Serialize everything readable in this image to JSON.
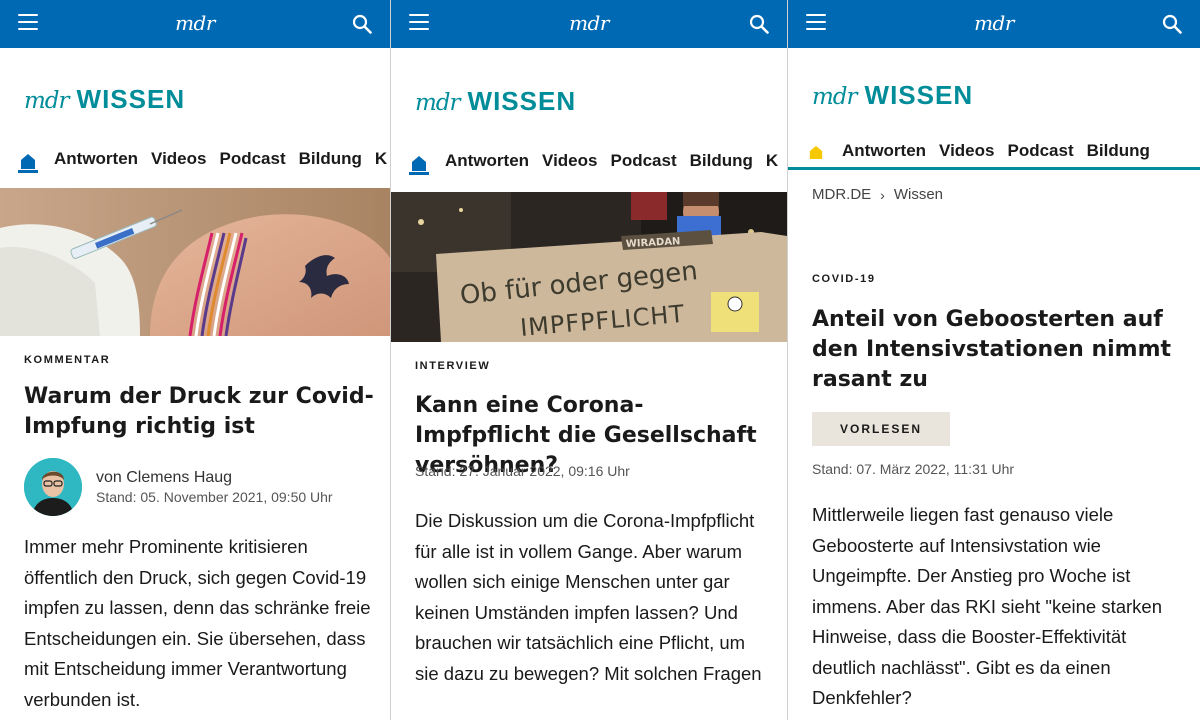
{
  "header": {
    "logo": "mdr"
  },
  "brand": {
    "prefix": "mdr",
    "name": "WISSEN"
  },
  "nav": {
    "items": [
      "Antworten",
      "Videos",
      "Podcast",
      "Bildung"
    ]
  },
  "panels": [
    {
      "kicker": "KOMMENTAR",
      "headline": "Warum der Druck zur Covid-Impfung richtig ist",
      "author": "von Clemens Haug",
      "stand": "Stand: 05. November 2021, 09:50 Uhr",
      "lead": "Immer mehr Prominente kritisieren öffentlich den Druck, sich gegen Covid-19 impfen zu lassen, denn das schränke freie Entscheidungen ein. Sie übersehen, dass mit Entscheidung immer Verantwortung verbunden ist."
    },
    {
      "kicker": "INTERVIEW",
      "headline": "Kann eine Corona-Impfpflicht die Gesellschaft versöhnen?",
      "stand": "Stand: 27. Januar 2022, 09:16 Uhr",
      "lead": "Die Diskussion um die Corona-Impfpflicht für alle ist in vollem Gange. Aber warum wollen sich einige Menschen unter gar keinen Umständen impfen lassen? Und brauchen wir tatsächlich eine Pflicht, um sie dazu zu bewegen? Mit solchen Fragen",
      "sign": {
        "line1": "Ob für oder gegen",
        "line2": "IMPFPFLICHT",
        "top_strip": "WIRADAN"
      }
    },
    {
      "breadcrumb": [
        "MDR.DE",
        "Wissen"
      ],
      "kicker": "COVID-19",
      "headline": "Anteil von Geboosterten auf den Intensivstationen nimmt rasant zu",
      "vorlesen": "VORLESEN",
      "stand": "Stand: 07. März 2022, 11:31 Uhr",
      "lead": "Mittlerweile liegen fast genauso viele Geboosterte auf Intensivstation wie Ungeimpfte. Der Anstieg pro Woche ist immens. Aber das RKI sieht \"keine starken Hinweise, dass die Booster-Effektivität deutlich nachlässt\". Gibt es da einen Denkfehler?"
    }
  ],
  "colors": {
    "header": "#0069b4",
    "brand": "#008d99",
    "home_active_yellow": "#f5c800"
  }
}
